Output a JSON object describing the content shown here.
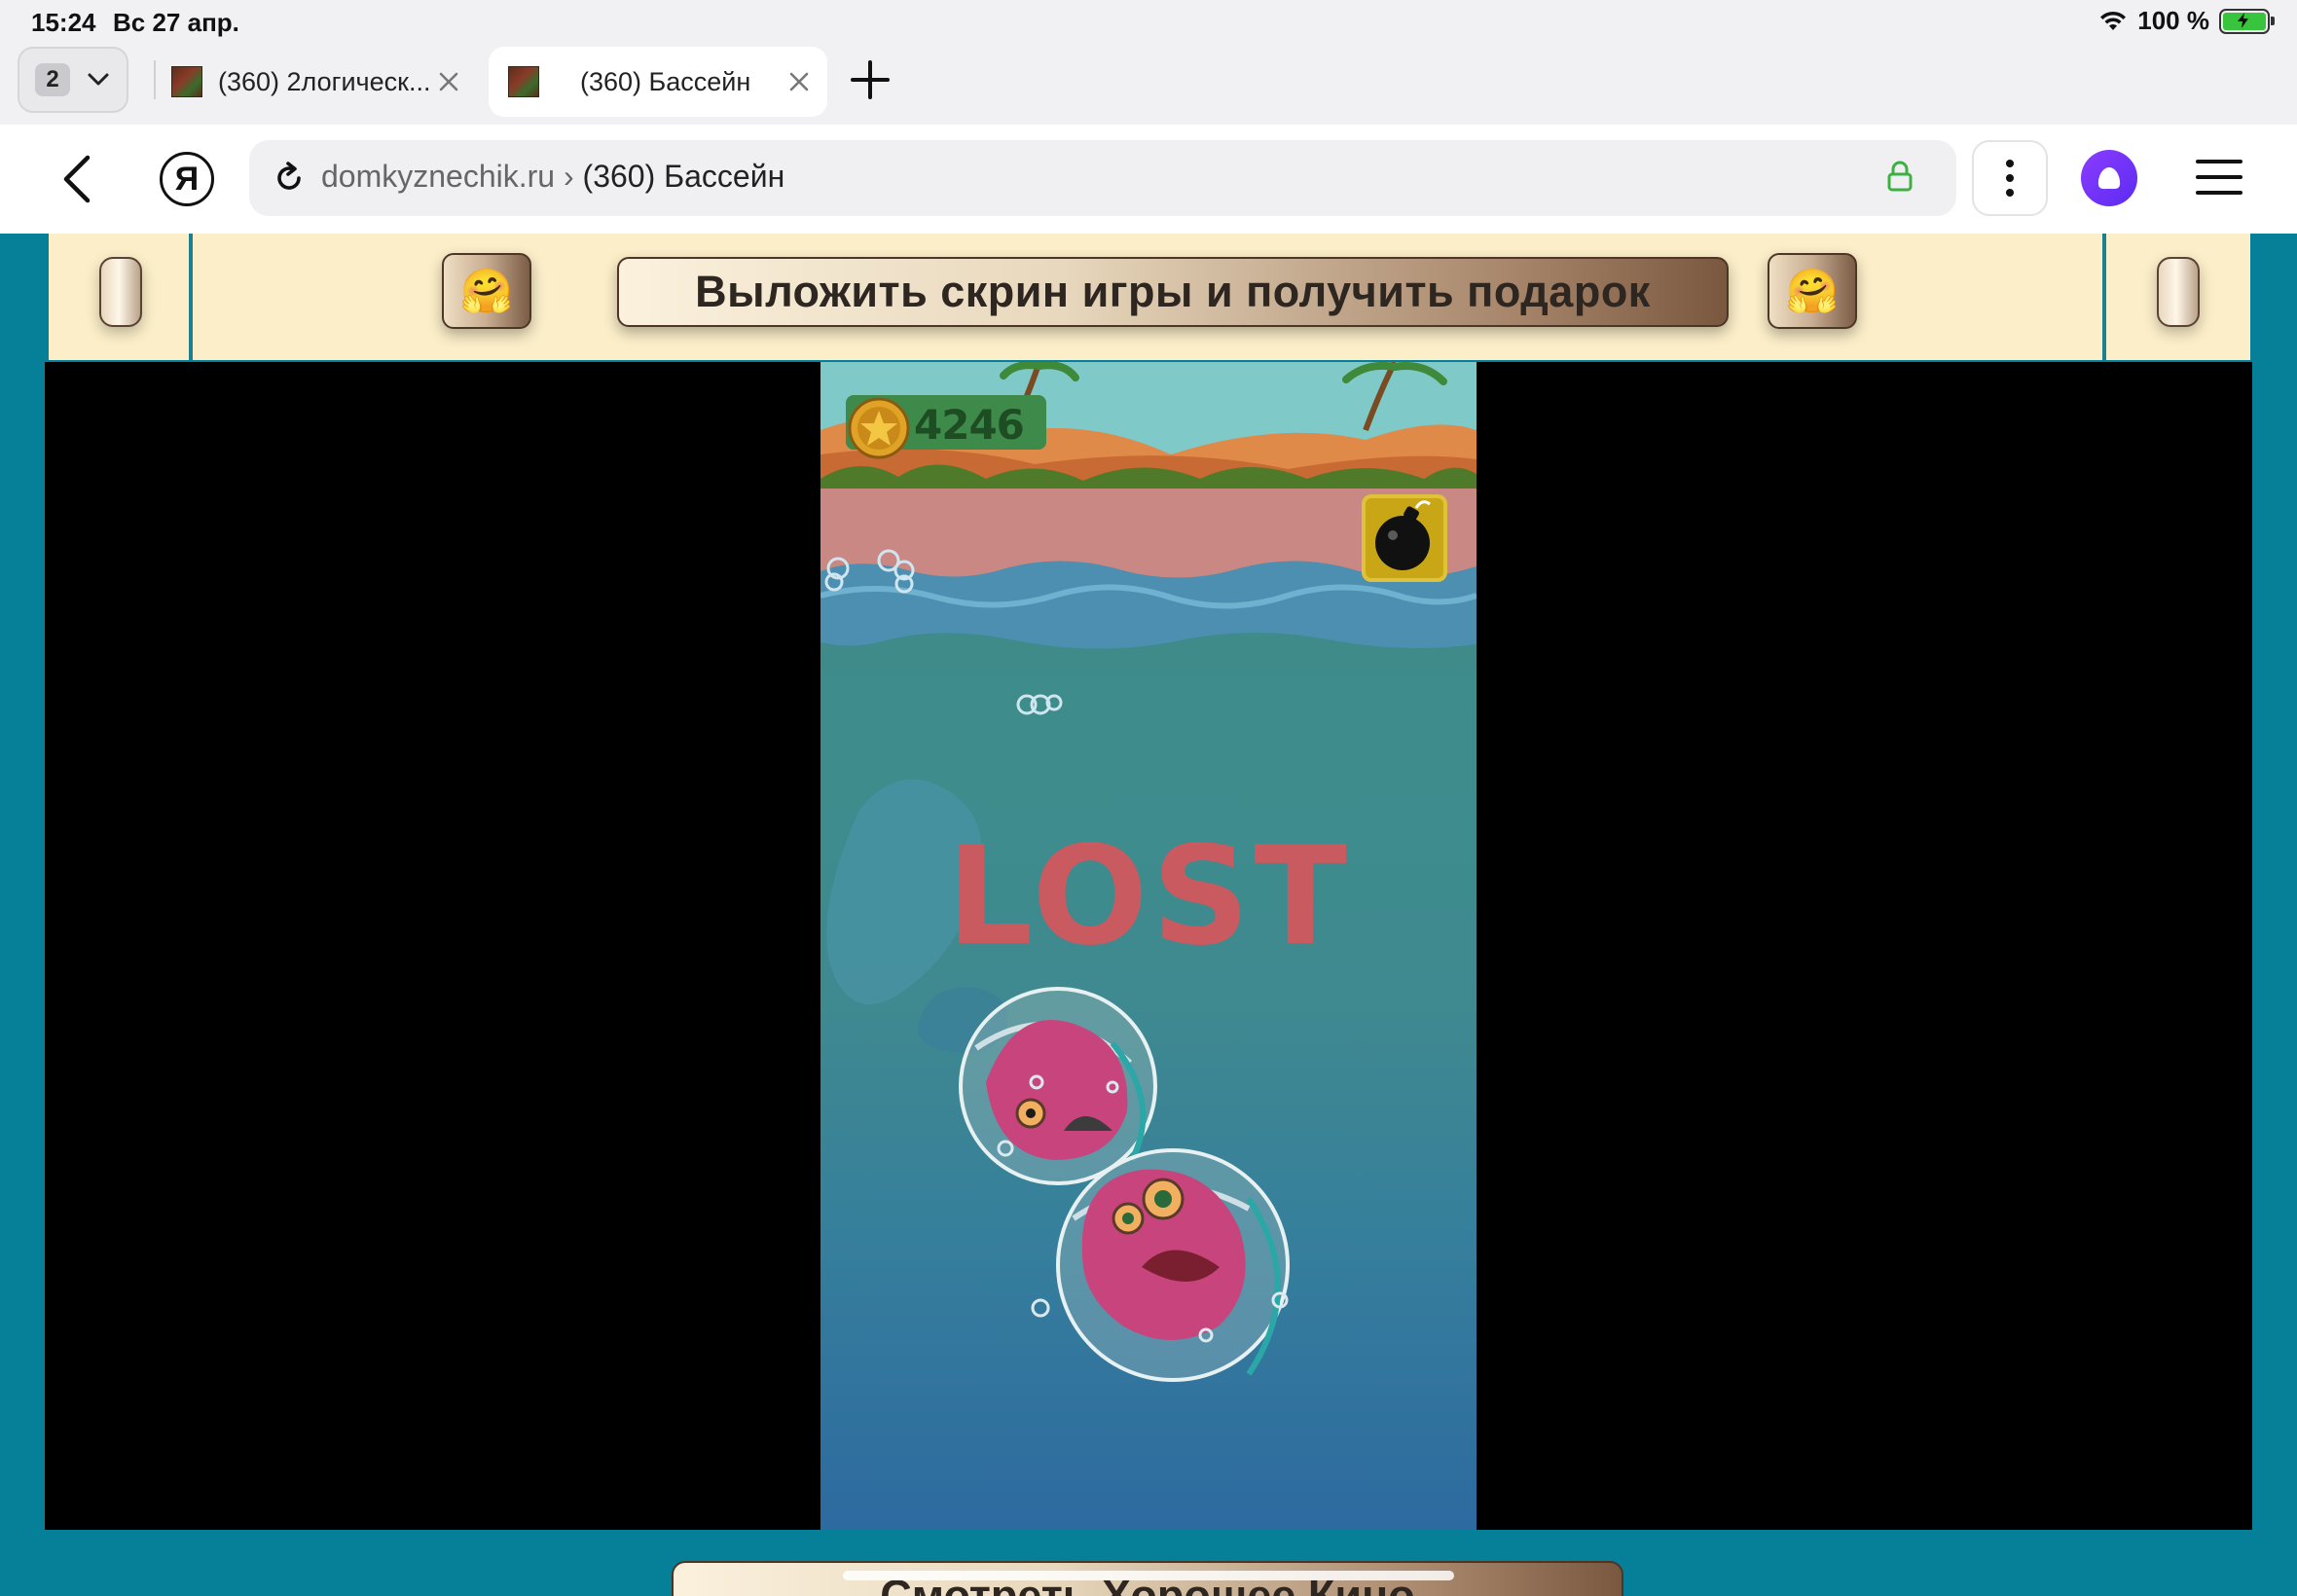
{
  "status_bar": {
    "time": "15:24",
    "date": "Вс 27 апр.",
    "battery": "100 %",
    "icons": [
      "wifi-icon",
      "battery-charging-icon"
    ]
  },
  "tabs": {
    "count": "2",
    "items": [
      {
        "title": "(360) 2логическ...",
        "active": false
      },
      {
        "title": "(360) Бассейн",
        "active": true
      }
    ]
  },
  "address_bar": {
    "domain": "domkyznechik.ru",
    "separator": " › ",
    "page_title": "(360) Бассейн",
    "yandex_letter": "Я",
    "accent_color": "#6a33f5",
    "secure_color": "#3cb043"
  },
  "banner": {
    "button_label": "Выложить скрин игры и получить подарок",
    "emoji_left": "🤗",
    "emoji_right": "🤗",
    "background": "#fbeec8"
  },
  "game": {
    "score": "4246",
    "status_text": "LOST",
    "icons": [
      "coin-star-icon",
      "bomb-icon"
    ]
  },
  "bottom": {
    "button_label": "Смотреть Хорошее Кино"
  },
  "colors": {
    "page_background": "#067f98",
    "game_frame": "#000000",
    "lost_text": "#c85a60"
  }
}
